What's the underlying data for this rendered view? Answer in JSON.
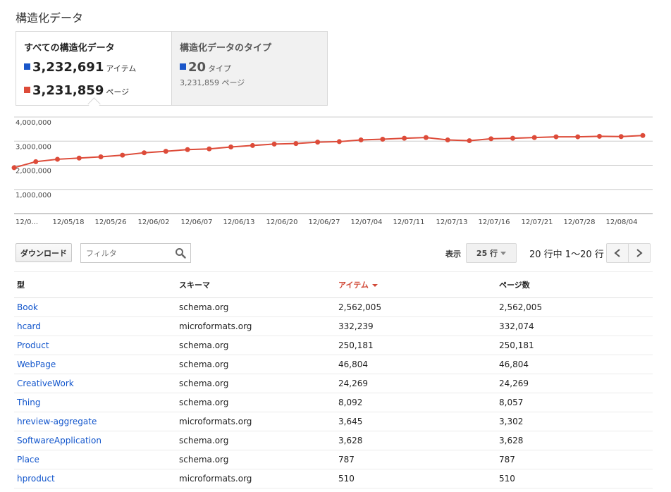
{
  "page_title": "構造化データ",
  "tabs": [
    {
      "title": "すべての構造化データ",
      "metrics": [
        {
          "value": "3,232,691",
          "unit": "アイテム",
          "color": "#1a56c9"
        },
        {
          "value": "3,231,859",
          "unit": "ページ",
          "color": "#dd4b39"
        }
      ]
    },
    {
      "title": "構造化データのタイプ",
      "metric": {
        "value": "20",
        "unit": "タイプ",
        "color": "#1a56c9"
      },
      "sub": "3,231,859 ページ"
    }
  ],
  "chart_data": {
    "type": "line",
    "ylim": [
      0,
      4000000
    ],
    "yticks": [
      "4,000,000",
      "3,000,000",
      "2,000,000",
      "1,000,000"
    ],
    "xticks": [
      "12/0...",
      "12/05/18",
      "12/05/26",
      "12/06/02",
      "12/06/07",
      "12/06/13",
      "12/06/20",
      "12/06/27",
      "12/07/04",
      "12/07/11",
      "12/07/13",
      "12/07/16",
      "12/07/21",
      "12/07/28",
      "12/08/04"
    ],
    "series": [
      {
        "color": "#dd4b39",
        "values": [
          1900000,
          2150000,
          2250000,
          2300000,
          2350000,
          2420000,
          2520000,
          2580000,
          2650000,
          2680000,
          2760000,
          2820000,
          2880000,
          2900000,
          2960000,
          2980000,
          3050000,
          3080000,
          3120000,
          3150000,
          3050000,
          3020000,
          3100000,
          3120000,
          3150000,
          3180000,
          3180000,
          3200000,
          3190000,
          3232691
        ]
      }
    ]
  },
  "toolbar": {
    "download_label": "ダウンロード",
    "filter_placeholder": "フィルタ",
    "show_label": "表示",
    "rows_select": "25 行",
    "page_info": "20 行中 1〜20 行"
  },
  "table": {
    "headers": [
      "型",
      "スキーマ",
      "アイテム",
      "ページ数"
    ],
    "rows": [
      [
        "Book",
        "schema.org",
        "2,562,005",
        "2,562,005"
      ],
      [
        "hcard",
        "microformats.org",
        "332,239",
        "332,074"
      ],
      [
        "Product",
        "schema.org",
        "250,181",
        "250,181"
      ],
      [
        "WebPage",
        "schema.org",
        "46,804",
        "46,804"
      ],
      [
        "CreativeWork",
        "schema.org",
        "24,269",
        "24,269"
      ],
      [
        "Thing",
        "schema.org",
        "8,092",
        "8,057"
      ],
      [
        "hreview-aggregate",
        "microformats.org",
        "3,645",
        "3,302"
      ],
      [
        "SoftwareApplication",
        "schema.org",
        "3,628",
        "3,628"
      ],
      [
        "Place",
        "schema.org",
        "787",
        "787"
      ],
      [
        "hproduct",
        "microformats.org",
        "510",
        "510"
      ]
    ]
  }
}
